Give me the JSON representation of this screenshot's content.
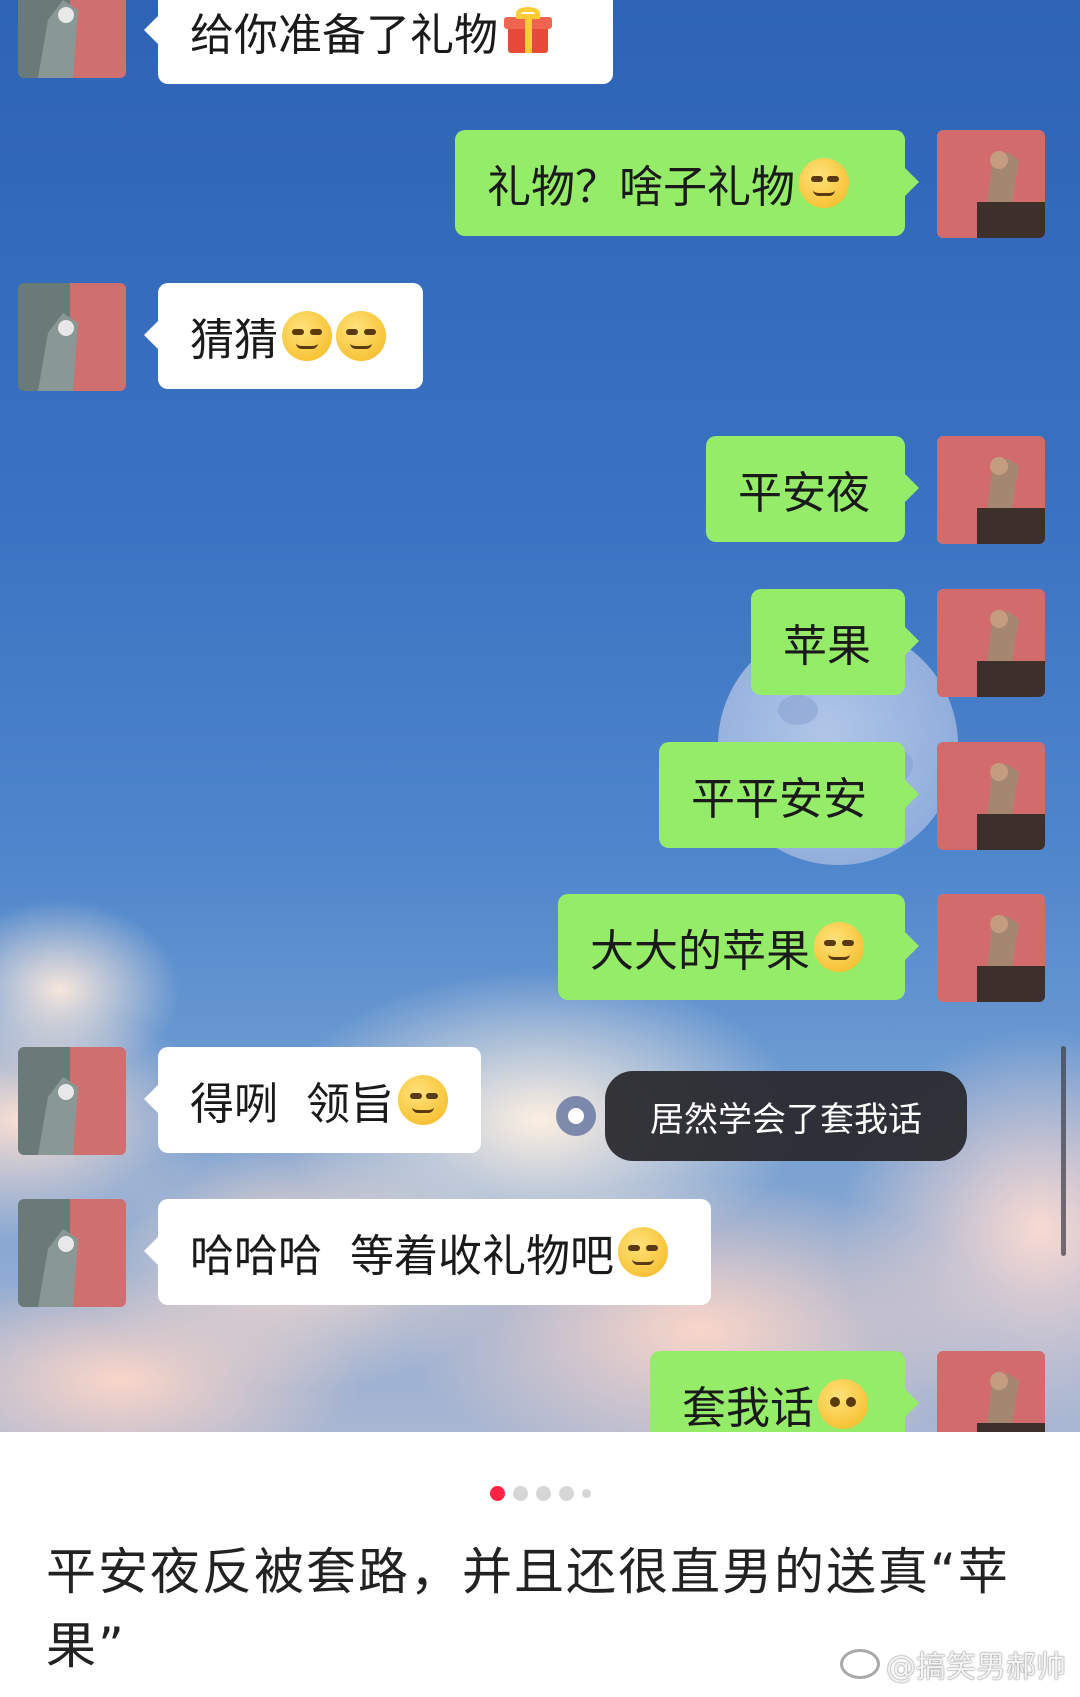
{
  "chat": {
    "messages": [
      {
        "side": "left",
        "text": "给你准备了礼物",
        "emoji": "gift-icon"
      },
      {
        "side": "right",
        "text": "礼物？啥子礼物",
        "emoji": "thinking-face-icon"
      },
      {
        "side": "left",
        "text": "猜猜",
        "emoji": "smirk-face-icon"
      },
      {
        "side": "right",
        "text": "平安夜"
      },
      {
        "side": "right",
        "text": "苹果"
      },
      {
        "side": "right",
        "text": "平平安安"
      },
      {
        "side": "right",
        "text": "大大的苹果",
        "emoji": "smirk-face-icon"
      },
      {
        "side": "left",
        "text": "得咧  领旨",
        "emoji": "thinking-face-icon"
      },
      {
        "side": "left",
        "text": "哈哈哈  等着收礼物吧",
        "emoji": "smirk-face-icon"
      },
      {
        "side": "right",
        "text": "套我话",
        "emoji": "surprised-face-icon"
      }
    ],
    "tooltip": "居然学会了套我话"
  },
  "pager": {
    "count": 5,
    "active": 0
  },
  "caption": "平安夜反被套路，并且还很直男的送真“苹果”",
  "watermark": "@搞笑男郝帅",
  "colors": {
    "green_bubble": "#95ec69",
    "white_bubble": "#ffffff",
    "pager_active": "#ff2442"
  }
}
